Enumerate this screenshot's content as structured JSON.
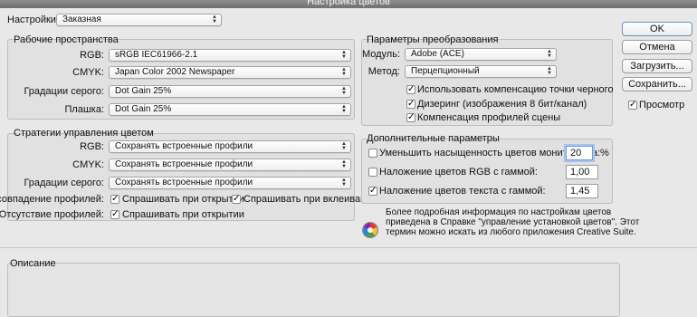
{
  "window": {
    "title": "Настройка цветов"
  },
  "settings": {
    "label": "Настройки:",
    "value": "Заказная"
  },
  "workspaces": {
    "title": "Рабочие пространства",
    "rows": [
      {
        "label": "RGB:",
        "value": "sRGB IEC61966-2.1"
      },
      {
        "label": "CMYK:",
        "value": "Japan Color 2002 Newspaper"
      },
      {
        "label": "Градации серого:",
        "value": "Dot Gain 25%"
      },
      {
        "label": "Плашка:",
        "value": "Dot Gain 25%"
      }
    ]
  },
  "policies": {
    "title": "Стратегии управления цветом",
    "rows": [
      {
        "label": "RGB:",
        "value": "Сохранять встроенные профили"
      },
      {
        "label": "CMYK:",
        "value": "Сохранять встроенные профили"
      },
      {
        "label": "Градации серого:",
        "value": "Сохранять встроенные профили"
      }
    ],
    "mismatch_label": "Несовпадение профилей:",
    "mismatch_open": {
      "label": "Спрашивать при открытии",
      "checked": true
    },
    "mismatch_paste": {
      "label": "Спрашивать при вклеивании",
      "checked": true
    },
    "missing_label": "Отсутствие профилей:",
    "missing_open": {
      "label": "Спрашивать при открытии",
      "checked": true
    }
  },
  "conversion": {
    "title": "Параметры преобразования",
    "module_label": "Модуль:",
    "module_value": "Adobe (ACE)",
    "method_label": "Метод:",
    "method_value": "Перцепционный",
    "black_point": {
      "label": "Использовать компенсацию точки черного",
      "checked": true
    },
    "dither": {
      "label": "Дизеринг (изображения 8 бит/канал)",
      "checked": true
    },
    "scene": {
      "label": "Компенсация профилей сцены",
      "checked": true
    }
  },
  "advanced": {
    "title": "Дополнительные параметры",
    "desaturate": {
      "label": "Уменьшить насыщенность цветов монитора на:",
      "checked": false,
      "value": "20",
      "unit": "%"
    },
    "blend_rgb": {
      "label": "Наложение цветов RGB с гаммой:",
      "checked": false,
      "value": "1,00"
    },
    "blend_text": {
      "label": "Наложение цветов текста с гаммой:",
      "checked": true,
      "value": "1,45"
    }
  },
  "info": {
    "icon": "color-wheel-icon",
    "line1": "Более подробная информация по настройкам цветов",
    "line2": "приведена в Справке \"управление установкой цветов\". Этот",
    "line3": "термин можно искать из любого приложения Creative Suite."
  },
  "description": {
    "title": "Описание"
  },
  "buttons": {
    "ok": "OK",
    "cancel": "Отмена",
    "load": "Загрузить...",
    "save": "Сохранить..."
  },
  "preview": {
    "label": "Просмотр",
    "checked": true
  }
}
